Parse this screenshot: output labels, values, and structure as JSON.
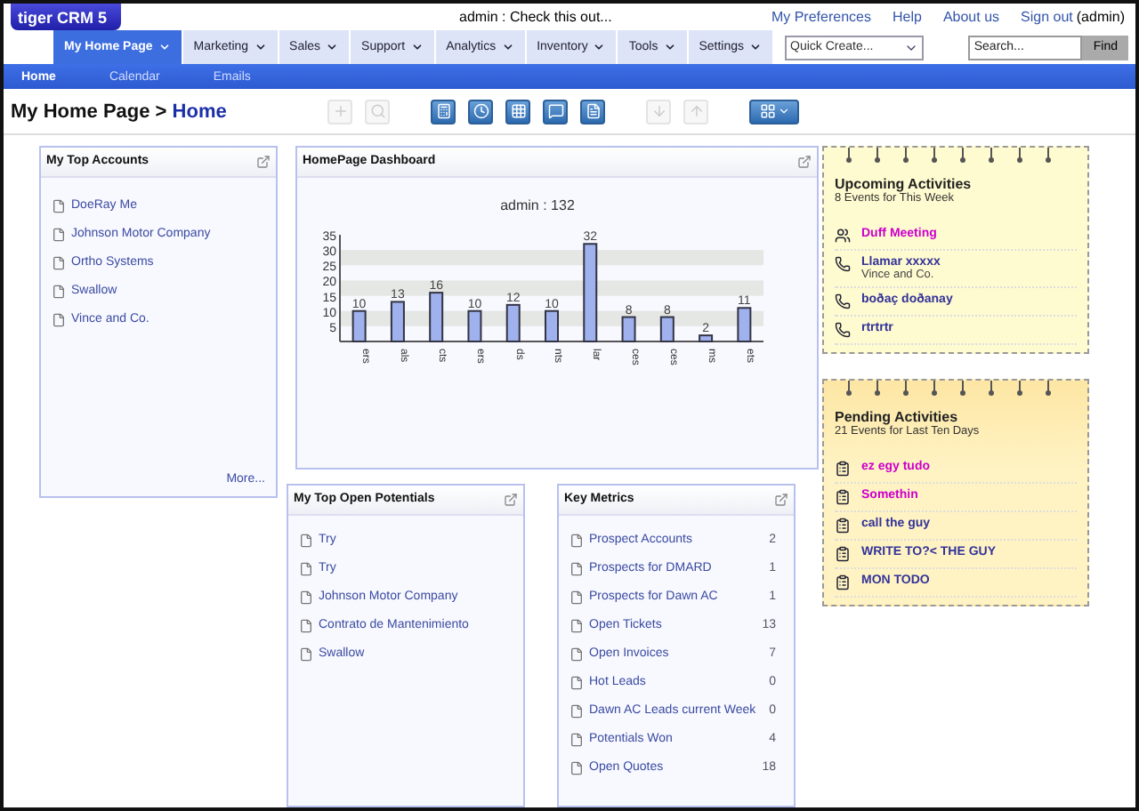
{
  "header": {
    "logo": "tiger CRM 5",
    "announcement": "admin : Check this out...",
    "links": [
      "My Preferences",
      "Help",
      "About us"
    ],
    "sign_out": "Sign out",
    "user": "(admin)"
  },
  "nav_tabs": [
    {
      "label": "My Home Page",
      "selected": true
    },
    {
      "label": "Marketing",
      "selected": false
    },
    {
      "label": "Sales",
      "selected": false
    },
    {
      "label": "Support",
      "selected": false
    },
    {
      "label": "Analytics",
      "selected": false
    },
    {
      "label": "Inventory",
      "selected": false
    },
    {
      "label": "Tools",
      "selected": false
    },
    {
      "label": "Settings",
      "selected": false
    }
  ],
  "quick_create": {
    "placeholder": "Quick Create..."
  },
  "search": {
    "placeholder": "Search...",
    "button": "Find"
  },
  "sub_tabs": [
    {
      "label": "Home",
      "selected": true
    },
    {
      "label": "Calendar",
      "selected": false
    },
    {
      "label": "Emails",
      "selected": false
    }
  ],
  "breadcrumb": {
    "module": "My Home Page >",
    "page": "Home"
  },
  "toolbar": [
    {
      "kind": "add",
      "disabled": true
    },
    {
      "kind": "search",
      "disabled": true
    },
    {
      "kind": "calculator",
      "disabled": false
    },
    {
      "kind": "clock",
      "disabled": false
    },
    {
      "kind": "calendar",
      "disabled": false
    },
    {
      "kind": "chat",
      "disabled": false
    },
    {
      "kind": "notes",
      "disabled": false
    },
    {
      "kind": "import",
      "disabled": true
    },
    {
      "kind": "export",
      "disabled": true
    },
    {
      "kind": "layout",
      "disabled": false
    }
  ],
  "top_accounts": {
    "title": "My Top Accounts",
    "items": [
      "DoeRay Me",
      "Johnson Motor Company",
      "Ortho Systems",
      "Swallow",
      "Vince and Co."
    ],
    "more": "More..."
  },
  "dashboard": {
    "title": "HomePage Dashboard",
    "chart_data": {
      "type": "bar",
      "title": "admin : 132",
      "categories": [
        "ers",
        "als",
        "cts",
        "ers",
        "ds",
        "nts",
        "lar",
        "ces",
        "ces",
        "ms",
        "ets"
      ],
      "values": [
        10,
        13,
        16,
        10,
        12,
        10,
        32,
        8,
        8,
        2,
        11
      ],
      "yticks": [
        5,
        10,
        15,
        20,
        25,
        30,
        35
      ],
      "ylim": [
        0,
        35
      ],
      "data_labels": true
    }
  },
  "open_potentials": {
    "title": "My Top Open Potentials",
    "items": [
      "Try",
      "Try",
      "Johnson Motor Company",
      "Contrato de Mantenimiento",
      "Swallow"
    ]
  },
  "key_metrics": {
    "title": "Key Metrics",
    "rows": [
      {
        "name": "Prospect Accounts",
        "count": "2"
      },
      {
        "name": "Prospects for DMARD",
        "count": "1"
      },
      {
        "name": "Prospects for Dawn AC",
        "count": "1"
      },
      {
        "name": "Open Tickets",
        "count": "13"
      },
      {
        "name": "Open Invoices",
        "count": "7"
      },
      {
        "name": "Hot Leads",
        "count": "0"
      },
      {
        "name": "Dawn AC Leads current Week",
        "count": "0"
      },
      {
        "name": "Potentials Won",
        "count": "4"
      },
      {
        "name": "Open Quotes",
        "count": "18"
      }
    ]
  },
  "upcoming": {
    "title": "Upcoming Activities",
    "subtitle": "8 Events for This Week",
    "items": [
      {
        "kind": "meeting",
        "title": "Duff Meeting",
        "color": "#cc00cc"
      },
      {
        "kind": "call",
        "title": "Llamar xxxxx",
        "detail": "Vince and Co.",
        "color": "#333399"
      },
      {
        "kind": "call",
        "title": "boðaç doðanay",
        "color": "#333399"
      },
      {
        "kind": "call",
        "title": "rtrtrtr",
        "color": "#333399"
      }
    ]
  },
  "pending": {
    "title": "Pending Activities",
    "subtitle": "21 Events for Last Ten Days",
    "items": [
      {
        "kind": "task",
        "title": "ez egy tudo",
        "color": "#cc00cc"
      },
      {
        "kind": "task",
        "title": "Somethin",
        "color": "#cc00cc"
      },
      {
        "kind": "task",
        "title": "call the guy",
        "color": "#333399"
      },
      {
        "kind": "task",
        "title": "WRITE TO?< THE GUY",
        "color": "#333399"
      },
      {
        "kind": "task",
        "title": "MON TODO",
        "color": "#333399"
      }
    ]
  }
}
